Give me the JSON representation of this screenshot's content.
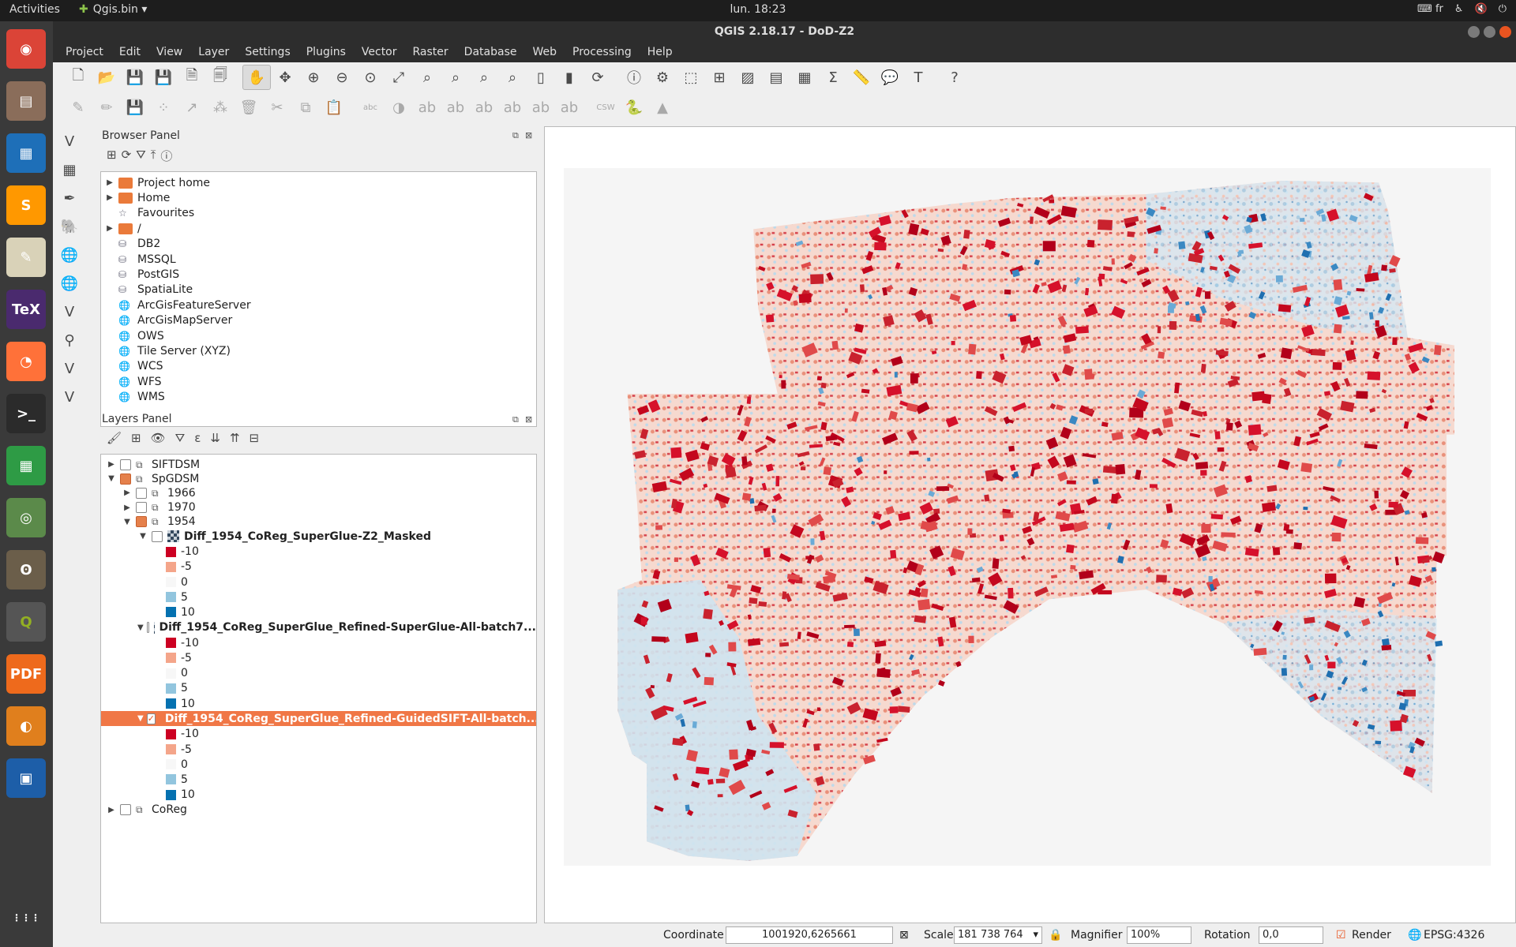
{
  "topbar": {
    "activities": "Activities",
    "app_name": "Qgis.bin",
    "clock": "lun. 18:23",
    "kbd": "fr",
    "tray_icons": [
      "keyboard-icon",
      "accessibility-icon",
      "volume-muted-icon",
      "power-icon"
    ]
  },
  "dock": {
    "items": [
      {
        "name": "chrome",
        "glyph": "◉",
        "color": "#db4437"
      },
      {
        "name": "files",
        "glyph": "▤",
        "color": "#8a6d5a"
      },
      {
        "name": "writer",
        "glyph": "▦",
        "color": "#1e6fb8"
      },
      {
        "name": "sublime",
        "glyph": "S",
        "color": "#ff9800"
      },
      {
        "name": "text-editor",
        "glyph": "✎",
        "color": "#d9d2b8"
      },
      {
        "name": "texmaker",
        "glyph": "TeX",
        "color": "#4a2a6e"
      },
      {
        "name": "firefox",
        "glyph": "◔",
        "color": "#ff7139"
      },
      {
        "name": "terminal",
        "glyph": ">_",
        "color": "#2b2b2b"
      },
      {
        "name": "calc",
        "glyph": "▦",
        "color": "#2e9b45"
      },
      {
        "name": "image-viewer",
        "glyph": "◎",
        "color": "#5b8a4a"
      },
      {
        "name": "gimp",
        "glyph": "ʘ",
        "color": "#6b5e4a"
      },
      {
        "name": "qgis",
        "glyph": "Q",
        "color": "#93b023"
      },
      {
        "name": "pdf-tool",
        "glyph": "PDF",
        "color": "#ee6a1c"
      },
      {
        "name": "blender",
        "glyph": "◐",
        "color": "#e07f1d"
      },
      {
        "name": "virtualbox",
        "glyph": "▣",
        "color": "#1d5ea8"
      },
      {
        "name": "apps-grid",
        "glyph": "⋮⋮⋮",
        "color": "#3a3a3a"
      }
    ]
  },
  "window": {
    "title": "QGIS 2.18.17 - DoD-Z2",
    "menu": [
      "Project",
      "Edit",
      "View",
      "Layer",
      "Settings",
      "Plugins",
      "Vector",
      "Raster",
      "Database",
      "Web",
      "Processing",
      "Help"
    ]
  },
  "toolbars": {
    "row1": [
      {
        "name": "new-project-icon",
        "g": "🗋"
      },
      {
        "name": "open-project-icon",
        "g": "📂"
      },
      {
        "name": "save-project-icon",
        "g": "💾"
      },
      {
        "name": "save-as-icon",
        "g": "💾"
      },
      {
        "name": "new-print-composer-icon",
        "g": "🗎"
      },
      {
        "name": "composer-manager-icon",
        "g": "🗐"
      },
      {
        "name": "sep"
      },
      {
        "name": "pan-map-icon",
        "g": "✋",
        "pressed": true
      },
      {
        "name": "pan-to-selection-icon",
        "g": "✥"
      },
      {
        "name": "zoom-in-icon",
        "g": "⊕"
      },
      {
        "name": "zoom-out-icon",
        "g": "⊖"
      },
      {
        "name": "zoom-1-1-icon",
        "g": "⊙"
      },
      {
        "name": "zoom-full-icon",
        "g": "⤢"
      },
      {
        "name": "zoom-selection-icon",
        "g": "⌕"
      },
      {
        "name": "zoom-layer-icon",
        "g": "⌕"
      },
      {
        "name": "zoom-last-icon",
        "g": "⌕"
      },
      {
        "name": "zoom-next-icon",
        "g": "⌕"
      },
      {
        "name": "new-bookmark-icon",
        "g": "▯"
      },
      {
        "name": "show-bookmarks-icon",
        "g": "▮"
      },
      {
        "name": "refresh-icon",
        "g": "⟳"
      },
      {
        "name": "sep"
      },
      {
        "name": "identify-icon",
        "g": "ⓘ"
      },
      {
        "name": "action-icon",
        "g": "⚙"
      },
      {
        "name": "select-features-icon",
        "g": "⬚"
      },
      {
        "name": "select-by-value-icon",
        "g": "⊞"
      },
      {
        "name": "deselect-icon",
        "g": "▨"
      },
      {
        "name": "attribute-table-icon",
        "g": "▤"
      },
      {
        "name": "field-calculator-icon",
        "g": "▦"
      },
      {
        "name": "statistics-icon",
        "g": "Σ"
      },
      {
        "name": "measure-icon",
        "g": "📏"
      },
      {
        "name": "map-tips-icon",
        "g": "💬"
      },
      {
        "name": "text-annotation-icon",
        "g": "T"
      },
      {
        "name": "sep"
      },
      {
        "name": "help-icon",
        "g": "?"
      }
    ],
    "row2": [
      {
        "name": "current-edits-icon",
        "g": "✎"
      },
      {
        "name": "toggle-editing-icon",
        "g": "✏"
      },
      {
        "name": "save-edits-icon",
        "g": "💾"
      },
      {
        "name": "add-feature-icon",
        "g": "⁘"
      },
      {
        "name": "move-feature-icon",
        "g": "↗"
      },
      {
        "name": "node-tool-icon",
        "g": "⁂"
      },
      {
        "name": "delete-selected-icon",
        "g": "🗑"
      },
      {
        "name": "cut-features-icon",
        "g": "✂"
      },
      {
        "name": "copy-features-icon",
        "g": "⧉"
      },
      {
        "name": "paste-features-icon",
        "g": "📋"
      },
      {
        "name": "sep"
      },
      {
        "name": "label-toolbar-icon",
        "g": "abc"
      },
      {
        "name": "layer-style-icon",
        "g": "◑"
      },
      {
        "name": "label-highlight-icon",
        "g": "ab"
      },
      {
        "name": "pin-labels-icon",
        "g": "ab"
      },
      {
        "name": "show-hide-labels-icon",
        "g": "ab"
      },
      {
        "name": "move-label-icon",
        "g": "ab"
      },
      {
        "name": "rotate-label-icon",
        "g": "ab"
      },
      {
        "name": "change-label-icon",
        "g": "ab"
      },
      {
        "name": "sep"
      },
      {
        "name": "csw-icon",
        "g": "CSW"
      },
      {
        "name": "python-console-icon",
        "g": "🐍"
      },
      {
        "name": "profile-tool-icon",
        "g": "▲"
      }
    ],
    "vertical": [
      {
        "name": "add-vector-layer-icon",
        "g": "V"
      },
      {
        "name": "add-raster-layer-icon",
        "g": "▦"
      },
      {
        "name": "add-spatialite-icon",
        "g": "✒"
      },
      {
        "name": "add-postgis-icon",
        "g": "🐘"
      },
      {
        "name": "add-wms-icon",
        "g": "🌐"
      },
      {
        "name": "add-wcs-icon",
        "g": "🌐"
      },
      {
        "name": "add-wfs-icon",
        "g": "V"
      },
      {
        "name": "add-mssql-icon",
        "g": "⚲"
      },
      {
        "name": "add-delimited-text-icon",
        "g": "V"
      },
      {
        "name": "add-virtual-layer-icon",
        "g": "V"
      }
    ]
  },
  "browser_panel": {
    "title": "Browser Panel",
    "tools": [
      "add-selected-icon",
      "refresh-icon",
      "filter-icon",
      "collapse-all-icon",
      "info-icon"
    ],
    "items": [
      {
        "label": "Project home",
        "icon": "folder",
        "arrow": "▶"
      },
      {
        "label": "Home",
        "icon": "folder",
        "arrow": "▶"
      },
      {
        "label": "Favourites",
        "icon": "star",
        "arrow": ""
      },
      {
        "label": "/",
        "icon": "folder",
        "arrow": "▶"
      },
      {
        "label": "DB2",
        "icon": "db",
        "arrow": ""
      },
      {
        "label": "MSSQL",
        "icon": "db",
        "arrow": ""
      },
      {
        "label": "PostGIS",
        "icon": "db",
        "arrow": ""
      },
      {
        "label": "SpatiaLite",
        "icon": "db",
        "arrow": ""
      },
      {
        "label": "ArcGisFeatureServer",
        "icon": "globe",
        "arrow": ""
      },
      {
        "label": "ArcGisMapServer",
        "icon": "globe",
        "arrow": ""
      },
      {
        "label": "OWS",
        "icon": "globe",
        "arrow": ""
      },
      {
        "label": "Tile Server (XYZ)",
        "icon": "globe",
        "arrow": ""
      },
      {
        "label": "WCS",
        "icon": "globe",
        "arrow": ""
      },
      {
        "label": "WFS",
        "icon": "globe",
        "arrow": ""
      },
      {
        "label": "WMS",
        "icon": "globe",
        "arrow": ""
      }
    ]
  },
  "layers_panel": {
    "title": "Layers Panel",
    "tools": [
      "style-icon",
      "add-group-icon",
      "visibility-icon",
      "filter-legend-icon",
      "expression-filter-icon",
      "expand-all-icon",
      "collapse-all-icon",
      "remove-layer-icon"
    ],
    "legend": [
      {
        "label": "-10",
        "color": "#cc0022"
      },
      {
        "label": "-5",
        "color": "#f4a58a"
      },
      {
        "label": "0",
        "color": "#f7f7f7"
      },
      {
        "label": "5",
        "color": "#92c5de"
      },
      {
        "label": "10",
        "color": "#0571b0"
      }
    ],
    "rows": [
      {
        "type": "group",
        "label": "SIFTDSM",
        "depth": 0,
        "arrow": "▶",
        "check": "off"
      },
      {
        "type": "group",
        "label": "SpGDSM",
        "depth": 0,
        "arrow": "▼",
        "check": "partial"
      },
      {
        "type": "group",
        "label": "1966",
        "depth": 1,
        "arrow": "▶",
        "check": "off"
      },
      {
        "type": "group",
        "label": "1970",
        "depth": 1,
        "arrow": "▶",
        "check": "off"
      },
      {
        "type": "group",
        "label": "1954",
        "depth": 1,
        "arrow": "▼",
        "check": "partial"
      },
      {
        "type": "layer",
        "label": "Diff_1954_CoReg_SuperGlue-Z2_Masked",
        "depth": 2,
        "arrow": "▼",
        "check": "off",
        "selected": false
      },
      {
        "type": "legend"
      },
      {
        "type": "layer",
        "label": "Diff_1954_CoReg_SuperGlue_Refined-SuperGlue-All-batch7...",
        "depth": 2,
        "arrow": "▼",
        "check": "off",
        "selected": false
      },
      {
        "type": "legend"
      },
      {
        "type": "layer",
        "label": "Diff_1954_CoReg_SuperGlue_Refined-GuidedSIFT-All-batch...",
        "depth": 2,
        "arrow": "▼",
        "check": "on",
        "selected": true
      },
      {
        "type": "legend"
      },
      {
        "type": "group",
        "label": "CoReg",
        "depth": 0,
        "arrow": "▶",
        "check": "off"
      }
    ]
  },
  "statusbar": {
    "coordinate_label": "Coordinate",
    "coordinate_value": "1001920,6265661",
    "scale_label": "Scale",
    "scale_value": "181 738 764",
    "magnifier_label": "Magnifier",
    "magnifier_value": "100%",
    "rotation_label": "Rotation",
    "rotation_value": "0,0",
    "render_label": "Render",
    "crs_label": "EPSG:4326"
  }
}
